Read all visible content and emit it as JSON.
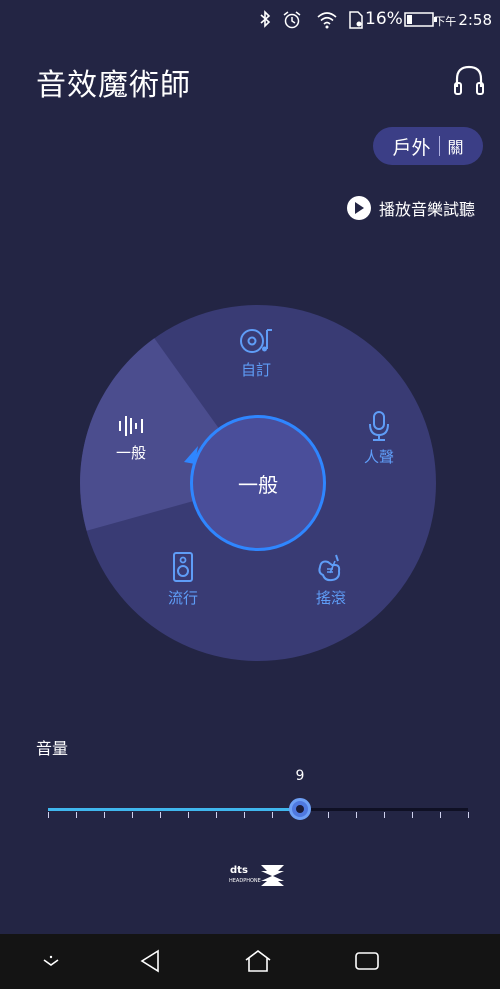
{
  "status_bar": {
    "battery_percent": "16%",
    "ampm": "下午",
    "time": "2:58"
  },
  "header": {
    "title": "音效魔術師"
  },
  "outdoor_toggle": {
    "label": "戶外",
    "state": "關"
  },
  "preview": {
    "label": "播放音樂試聽"
  },
  "presets": {
    "custom": "自訂",
    "general": "一般",
    "vocal": "人聲",
    "pop": "流行",
    "rock": "搖滾"
  },
  "center": {
    "label": "一般"
  },
  "volume": {
    "label": "音量",
    "value": "9",
    "level": 9,
    "max": 15
  },
  "colors": {
    "background": "#232544",
    "wheel": "#393b74",
    "accent": "#2f86ff",
    "preset_text": "#5f9df7"
  }
}
